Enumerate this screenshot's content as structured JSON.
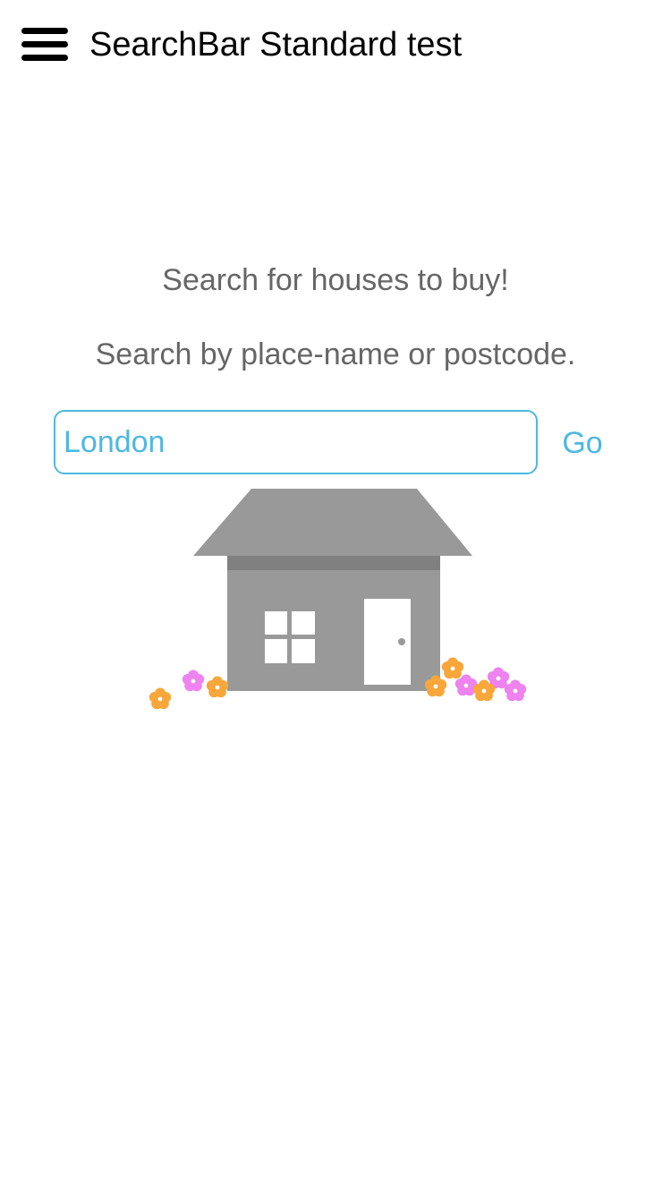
{
  "header": {
    "title": "SearchBar Standard test",
    "menu_icon": "hamburger-menu-icon"
  },
  "main": {
    "headline": "Search for houses to buy!",
    "subline": "Search by place-name or postcode.",
    "search": {
      "value": "London",
      "placeholder": ""
    },
    "go_label": "Go",
    "illustration": "house-with-flowers"
  },
  "colors": {
    "accent": "#4db8e0",
    "text_gray": "#666666",
    "house_gray": "#999999",
    "house_band": "#808080",
    "flower_orange": "#f9a63a",
    "flower_pink": "#ee82ee"
  }
}
